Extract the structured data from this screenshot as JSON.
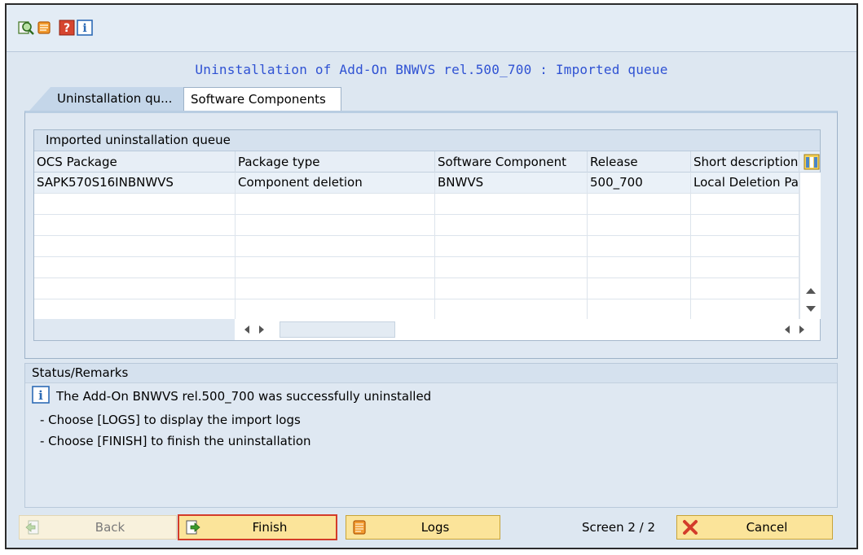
{
  "toolbar": {
    "icons": [
      "find-icon",
      "scroll-log-icon",
      "help-icon",
      "info-icon"
    ]
  },
  "title": "Uninstallation of Add-On BNWVS rel.500_700 : Imported queue",
  "tabs": [
    {
      "label": "Uninstallation qu...",
      "active": true
    },
    {
      "label": "Software Components",
      "active": false
    }
  ],
  "queue": {
    "title": "Imported uninstallation queue",
    "columns": [
      "OCS Package",
      "Package type",
      "Software Component",
      "Release",
      "Short description"
    ],
    "rows": [
      [
        "SAPK570S16INBNWVS",
        "Component deletion",
        "BNWVS",
        "500_700",
        "Local Deletion Pa"
      ]
    ],
    "empty_rows": 6
  },
  "status": {
    "title": "Status/Remarks",
    "lines": [
      "The Add-On BNWVS rel.500_700 was successfully uninstalled",
      "- Choose [LOGS] to display the import logs",
      "- Choose [FINISH] to finish the uninstallation"
    ]
  },
  "buttons": {
    "back": "Back",
    "finish": "Finish",
    "logs": "Logs",
    "cancel": "Cancel"
  },
  "screen_indicator": "Screen 2 / 2",
  "colors": {
    "title": "#2f52d3",
    "button_bg": "#fbe49a",
    "focus_outline": "#d33c2a",
    "panel_bg": "#dfe8f2"
  }
}
